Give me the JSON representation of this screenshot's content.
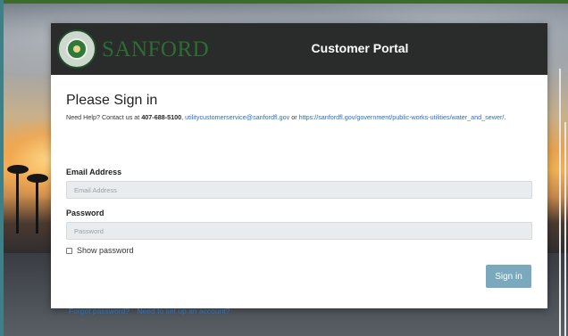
{
  "header": {
    "logo_text": "SANFORD",
    "title": "Customer Portal"
  },
  "form": {
    "heading": "Please Sign in",
    "help": {
      "prefix": "Need Help? Contact us at ",
      "phone": "407-688-5100",
      "sep1": ", ",
      "email": "utilitycustomerservice@sanfordfl.gov",
      "sep2": " or ",
      "url": "https://sanfordfl.gov/government/public-works-utilities/water_and_sewer/",
      "suffix": "."
    },
    "email_label": "Email Address",
    "email_placeholder": "Email Address",
    "email_value": "",
    "password_label": "Password",
    "password_placeholder": "Password",
    "password_value": "",
    "show_password_label": "Show password",
    "show_password_checked": false,
    "submit_label": "Sign in"
  },
  "links": {
    "forgot": "Forgot password?",
    "signup": "Need to set up an account?"
  },
  "colors": {
    "header_bg": "#2a2c2b",
    "button_bg": "#7aa9bd",
    "link": "#2c6fb5",
    "brand_green": "#2f6b35"
  },
  "icons": [
    "city-seal-icon",
    "checkbox-icon"
  ]
}
